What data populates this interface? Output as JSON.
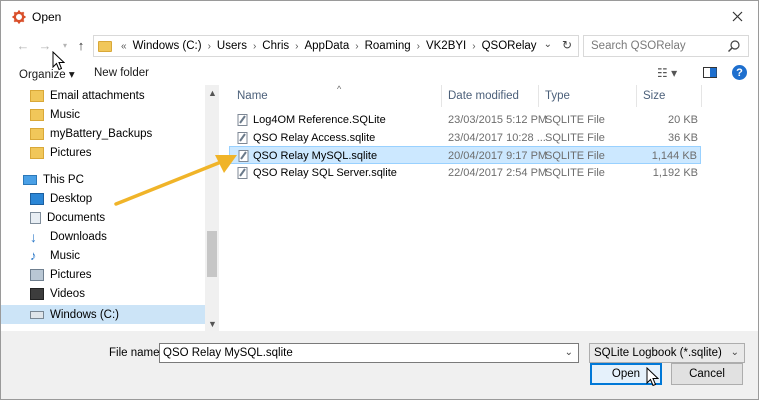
{
  "window": {
    "title": "Open"
  },
  "address": {
    "crumbs": [
      "Windows (C:)",
      "Users",
      "Chris",
      "AppData",
      "Roaming",
      "VK2BYI",
      "QSORelay"
    ],
    "overflow": "«"
  },
  "search": {
    "placeholder": "Search QSORelay"
  },
  "toolbar": {
    "organize": "Organize ▾",
    "new_folder": "New folder"
  },
  "sidebar": {
    "items": [
      {
        "label": "Email attachments",
        "icon": "folder-icon"
      },
      {
        "label": "Music",
        "icon": "folder-icon"
      },
      {
        "label": "myBattery_Backups",
        "icon": "folder-icon"
      },
      {
        "label": "Pictures",
        "icon": "folder-icon"
      },
      {
        "label": "This PC",
        "icon": "computer-icon"
      },
      {
        "label": "Desktop",
        "icon": "desktop-icon"
      },
      {
        "label": "Documents",
        "icon": "documents-icon"
      },
      {
        "label": "Downloads",
        "icon": "downloads-icon"
      },
      {
        "label": "Music",
        "icon": "music-icon"
      },
      {
        "label": "Pictures",
        "icon": "pictures-icon"
      },
      {
        "label": "Videos",
        "icon": "videos-icon"
      },
      {
        "label": "Windows (C:)",
        "icon": "drive-icon"
      }
    ]
  },
  "columns": {
    "name": "Name",
    "date": "Date modified",
    "type": "Type",
    "size": "Size"
  },
  "files": [
    {
      "name": "Log4OM Reference.SQLite",
      "date": "23/03/2015 5:12 PM",
      "type": "SQLITE File",
      "size": "20 KB"
    },
    {
      "name": "QSO Relay Access.sqlite",
      "date": "23/04/2017 10:28 ...",
      "type": "SQLITE File",
      "size": "36 KB"
    },
    {
      "name": "QSO Relay MySQL.sqlite",
      "date": "20/04/2017 9:17 PM",
      "type": "SQLITE File",
      "size": "1,144 KB"
    },
    {
      "name": "QSO Relay SQL Server.sqlite",
      "date": "22/04/2017 2:54 PM",
      "type": "SQLITE File",
      "size": "1,192 KB"
    }
  ],
  "selected_file_index": 2,
  "bottom": {
    "file_name_label": "File name:",
    "file_name_value": "QSO Relay MySQL.sqlite",
    "filter": "SQLite Logbook (*.sqlite)",
    "open": "Open",
    "cancel": "Cancel"
  },
  "colors": {
    "selection": "#cce8ff",
    "arrow": "#f0b429",
    "accent": "#0078d7"
  }
}
